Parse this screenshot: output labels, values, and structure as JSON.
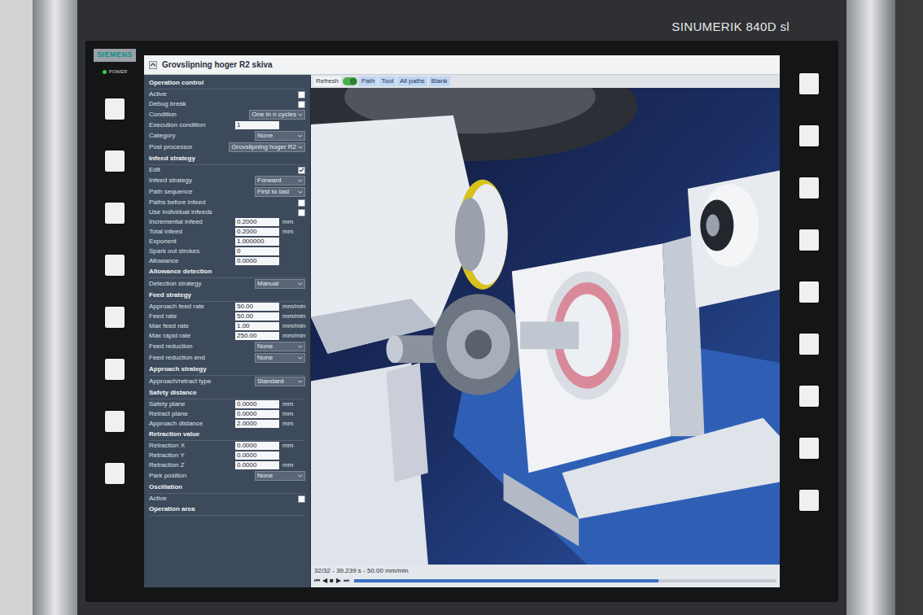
{
  "bezel": {
    "brand": "SIEMENS",
    "model": "SINUMERIK 840D sl",
    "power_label": "POWER"
  },
  "window": {
    "title": "Grovslipning hoger R2 skiva"
  },
  "toolbar": [
    {
      "kind": "button",
      "label": "Refresh",
      "selected": false
    },
    {
      "kind": "toggle",
      "label": "",
      "selected": false,
      "on": true
    },
    {
      "kind": "button",
      "label": "Path",
      "selected": true
    },
    {
      "kind": "button",
      "label": "Tool",
      "selected": true
    },
    {
      "kind": "button",
      "label": "All paths",
      "selected": true
    },
    {
      "kind": "button",
      "label": "Blank",
      "selected": true
    }
  ],
  "panel": {
    "sections": [
      {
        "title": "Operation control",
        "rows": [
          {
            "kind": "checkbox",
            "label": "Active",
            "checked": false
          },
          {
            "kind": "checkbox",
            "label": "Debug break",
            "checked": false
          },
          {
            "kind": "select",
            "label": "Condition",
            "value": "One in n cycles"
          },
          {
            "kind": "field",
            "label": "Execution condition",
            "value": "1",
            "unit": ""
          },
          {
            "kind": "select",
            "label": "Category",
            "value": "None"
          },
          {
            "kind": "select",
            "label": "Post processor",
            "value": "Grovslipning hoger R2"
          }
        ]
      },
      {
        "title": "Infeed strategy",
        "rows": [
          {
            "kind": "checkbox",
            "label": "Edit",
            "checked": true
          },
          {
            "kind": "select",
            "label": "Infeed strategy",
            "value": "Forward"
          },
          {
            "kind": "select",
            "label": "Path sequence",
            "value": "First to last"
          },
          {
            "kind": "checkbox",
            "label": "Paths before infeed",
            "checked": false
          },
          {
            "kind": "checkbox",
            "label": "Use individual infeeds",
            "checked": false
          },
          {
            "kind": "field",
            "label": "Incremental infeed",
            "value": "0.2000",
            "unit": "mm"
          },
          {
            "kind": "field",
            "label": "Total infeed",
            "value": "0.2000",
            "unit": "mm"
          },
          {
            "kind": "field",
            "label": "Exponent",
            "value": "1.000000",
            "unit": ""
          },
          {
            "kind": "field",
            "label": "Spark out strokes",
            "value": "0",
            "unit": ""
          },
          {
            "kind": "field",
            "label": "Allowance",
            "value": "0.0000",
            "unit": ""
          }
        ]
      },
      {
        "title": "Allowance detection",
        "rows": [
          {
            "kind": "select",
            "label": "Detection strategy",
            "value": "Manual"
          }
        ]
      },
      {
        "title": "Feed strategy",
        "rows": [
          {
            "kind": "field",
            "label": "Approach feed rate",
            "value": "50.00",
            "unit": "mm/min"
          },
          {
            "kind": "field",
            "label": "Feed rate",
            "value": "50.00",
            "unit": "mm/min"
          },
          {
            "kind": "field",
            "label": "Max feed rate",
            "value": "1.00",
            "unit": "mm/min"
          },
          {
            "kind": "field",
            "label": "Max rapid rate",
            "value": "250.00",
            "unit": "mm/min"
          },
          {
            "kind": "select",
            "label": "Feed reduction",
            "value": "None"
          },
          {
            "kind": "select",
            "label": "Feed reduction end",
            "value": "None"
          }
        ]
      },
      {
        "title": "Approach strategy",
        "rows": [
          {
            "kind": "select",
            "label": "Approach/retract type",
            "value": "Standard"
          }
        ]
      },
      {
        "title": "Safety distance",
        "rows": [
          {
            "kind": "field",
            "label": "Safety plane",
            "value": "0.0000",
            "unit": "mm"
          },
          {
            "kind": "field",
            "label": "Retract plane",
            "value": "0.0000",
            "unit": "mm"
          },
          {
            "kind": "field",
            "label": "Approach distance",
            "value": "2.0000",
            "unit": "mm"
          }
        ]
      },
      {
        "title": "Retraction value",
        "rows": [
          {
            "kind": "field",
            "label": "Retraction X",
            "value": "0.0000",
            "unit": "mm"
          },
          {
            "kind": "field",
            "label": "Retraction Y",
            "value": "0.0000",
            "unit": ""
          },
          {
            "kind": "field",
            "label": "Retraction Z",
            "value": "0.0000",
            "unit": "mm"
          },
          {
            "kind": "select",
            "label": "Park position",
            "value": "None"
          }
        ]
      },
      {
        "title": "Oscillation",
        "rows": [
          {
            "kind": "checkbox",
            "label": "Active",
            "checked": false
          }
        ]
      },
      {
        "title": "Operation area",
        "rows": []
      }
    ]
  },
  "status": {
    "text": "32/32 - 39.239 s - 50.00 mm/min",
    "controls": [
      "⏮",
      "◀",
      "■",
      "▶",
      "⏭"
    ],
    "progress": {
      "level": 0.72
    }
  }
}
